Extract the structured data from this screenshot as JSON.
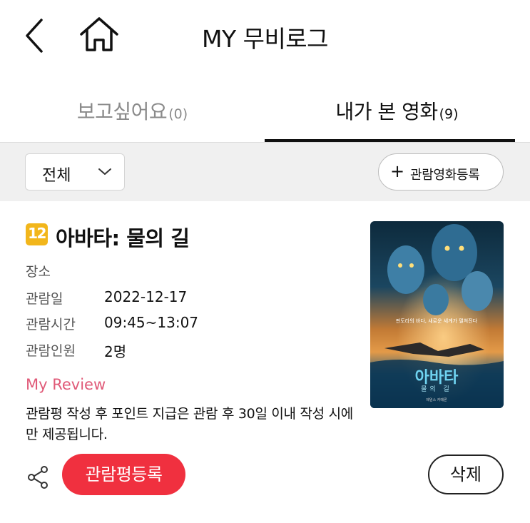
{
  "header": {
    "title": "MY 무비로그",
    "back_icon": "chevron-left-icon",
    "home_icon": "home-icon"
  },
  "tabs": [
    {
      "label": "보고싶어요",
      "count": "(0)",
      "active": false
    },
    {
      "label": "내가 본 영화",
      "count": "(9)",
      "active": true
    }
  ],
  "filter": {
    "selected": "전체",
    "add_label": "관람영화등록"
  },
  "movie": {
    "age_rating": "12",
    "age_color": "#f2b61b",
    "title": "아바타: 물의 길",
    "info": [
      {
        "label": "장소",
        "value": ""
      },
      {
        "label": "관람일",
        "value": "2022-12-17"
      },
      {
        "label": "관람시간",
        "value": "09:45~13:07"
      },
      {
        "label": "관람인원",
        "value": "2명"
      }
    ],
    "review": {
      "title": "My Review",
      "text": "관람평 작성 후 포인트 지급은 관람 후 30일 이내 작성 시에만 제공됩니다."
    },
    "poster": {
      "tagline": "판도라의 바다, 새로운 세계가 펼쳐진다",
      "title": "아바타",
      "subtitle": "물의 길",
      "credit": "제임스 카메론"
    }
  },
  "actions": {
    "review_button": "관람평등록",
    "delete_button": "삭제",
    "share_icon": "share-icon"
  },
  "colors": {
    "accent": "#f0303f",
    "review_title": "#e05a78",
    "filter_bg": "#f0f0f0"
  }
}
